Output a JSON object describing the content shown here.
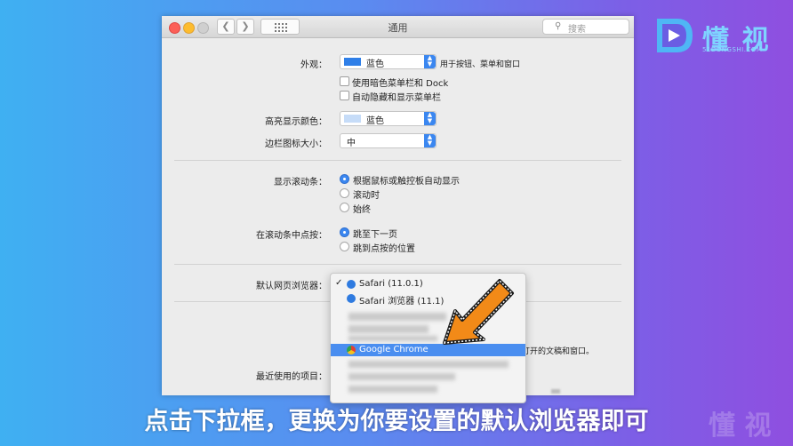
{
  "logo": {
    "text": "懂 视",
    "sub": "51DONGSHI.COM",
    "icon": "play-logo-icon"
  },
  "window": {
    "title": "通用",
    "search_placeholder": "搜索",
    "appearance": {
      "label": "外观：",
      "value": "蓝色",
      "note": "用于按钮、菜单和窗口"
    },
    "dark_menu_checkbox": "使用暗色菜单栏和 Dock",
    "autohide_checkbox": "自动隐藏和显示菜单栏",
    "highlight": {
      "label": "高亮显示颜色：",
      "value": "蓝色"
    },
    "sidebar_icon": {
      "label": "边栏图标大小：",
      "value": "中"
    },
    "scrollbars": {
      "label": "显示滚动条：",
      "options": [
        "根据鼠标或触控板自动显示",
        "滚动时",
        "始终"
      ]
    },
    "scroll_click": {
      "label": "在滚动条中点按：",
      "options": [
        "跳至下一页",
        "跳到点按的位置"
      ]
    },
    "default_browser": {
      "label": "默认网页浏览器："
    },
    "partial_text": "打开的文稿和窗口。",
    "recent_items": {
      "label": "最近使用的项目："
    }
  },
  "browser_menu": {
    "items": [
      "Safari (11.0.1)",
      "Safari 浏览器 (11.1)",
      "Google Chrome"
    ],
    "checked": "Safari (11.0.1)",
    "highlighted": "Google Chrome"
  },
  "caption": "点击下拉框，更换为你要设置的默认浏览器即可",
  "watermark": "懂 视",
  "colors": {
    "accent": "#3b87f0",
    "highlight_row": "#4a8ef0",
    "arrow": "#f28a18"
  }
}
